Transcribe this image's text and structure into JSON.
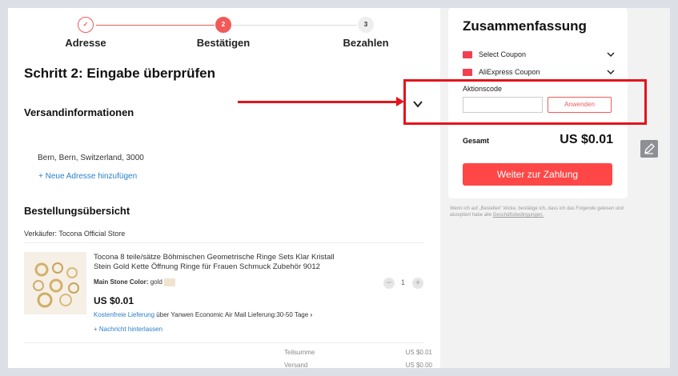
{
  "stepper": {
    "steps": [
      {
        "num": "✓",
        "label": "Adresse",
        "state": "done"
      },
      {
        "num": "2",
        "label": "Bestätigen",
        "state": "active"
      },
      {
        "num": "3",
        "label": "Bezahlen",
        "state": "todo"
      }
    ]
  },
  "main": {
    "title": "Schritt 2: Eingabe überprüfen",
    "shipping_heading": "Versandinformationen",
    "address": "Bern, Bern, Switzerland, 3000",
    "add_address": "+ Neue Adresse hinzufügen",
    "order_heading": "Bestellungsübersicht",
    "seller_prefix": "Verkäufer:",
    "seller_name": "Tocona Official Store",
    "product": {
      "title_line1": "Tocona 8 teile/sätze Böhmischen Geometrische Ringe Sets Klar Kristall",
      "title_line2": "Stein Gold Kette Öffnung Ringe für Frauen Schmuck Zubehör 9012",
      "variant_label": "Main Stone Color:",
      "variant_value": "gold",
      "price": "US $0.01",
      "shipping_free": "Kostenfreie Lieferung",
      "shipping_via": "über Yanwen Economic Air Mail",
      "shipping_time": "Lieferung:30-50 Tage",
      "message_link": "+ Nachricht hinterlassen",
      "quantity": "1"
    },
    "subtotal_label": "Teilsumme",
    "subtotal_value": "US $0.01",
    "shipping_label": "Versand",
    "shipping_value": "US $0.00"
  },
  "summary": {
    "title": "Zusammenfassung",
    "select_coupon": "Select Coupon",
    "ae_coupon": "AliExpress Coupon",
    "promo_label": "Aktionscode",
    "promo_placeholder": "",
    "apply_button": "Anwenden",
    "total_label": "Gesamt",
    "total_value": "US $0.01",
    "pay_button": "Weiter zur Zahlung",
    "note_prefix": "Wenn ich auf „Bestellen\" klicke, bestätige ich, dass ich das Folgende gelesen und akzeptiert habe alle",
    "note_link": "Geschäftsbedingungen."
  },
  "colors": {
    "accent": "#ff4747",
    "annotation": "#e3141b",
    "link": "#2a7fc8"
  }
}
